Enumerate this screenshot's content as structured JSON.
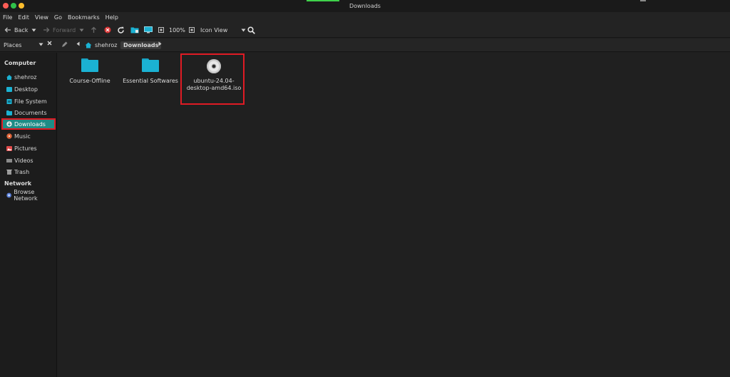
{
  "window": {
    "title": "Downloads"
  },
  "menu": [
    "File",
    "Edit",
    "View",
    "Go",
    "Bookmarks",
    "Help"
  ],
  "toolbar": {
    "back_label": "Back",
    "forward_label": "Forward",
    "zoom_label": "100%",
    "view_label": "Icon View"
  },
  "location": {
    "places_label": "Places",
    "crumbs": [
      "shehroz",
      "Downloads"
    ]
  },
  "sidebar": {
    "sections": [
      {
        "title": "Computer",
        "items": [
          {
            "label": "shehroz",
            "icon": "home-icon"
          },
          {
            "label": "Desktop",
            "icon": "desktop-icon"
          },
          {
            "label": "File System",
            "icon": "drive-icon"
          },
          {
            "label": "Documents",
            "icon": "documents-icon"
          },
          {
            "label": "Downloads",
            "icon": "download-icon",
            "selected": true
          },
          {
            "label": "Music",
            "icon": "music-icon"
          },
          {
            "label": "Pictures",
            "icon": "pictures-icon"
          },
          {
            "label": "Videos",
            "icon": "videos-icon"
          },
          {
            "label": "Trash",
            "icon": "trash-icon"
          }
        ]
      },
      {
        "title": "Network",
        "items": [
          {
            "label": "Browse Network",
            "icon": "network-icon"
          }
        ]
      }
    ]
  },
  "files": [
    {
      "name": "Course-Offline",
      "type": "folder"
    },
    {
      "name": "Essential Softwares",
      "type": "folder"
    },
    {
      "name_line1": "ubuntu-24.04-",
      "name_line2": "desktop-amd64.iso",
      "type": "disc-image",
      "highlighted": true
    }
  ],
  "colors": {
    "accent": "#1e8c86",
    "highlight_border": "#e01b24",
    "folder": "#1bb2d3"
  }
}
